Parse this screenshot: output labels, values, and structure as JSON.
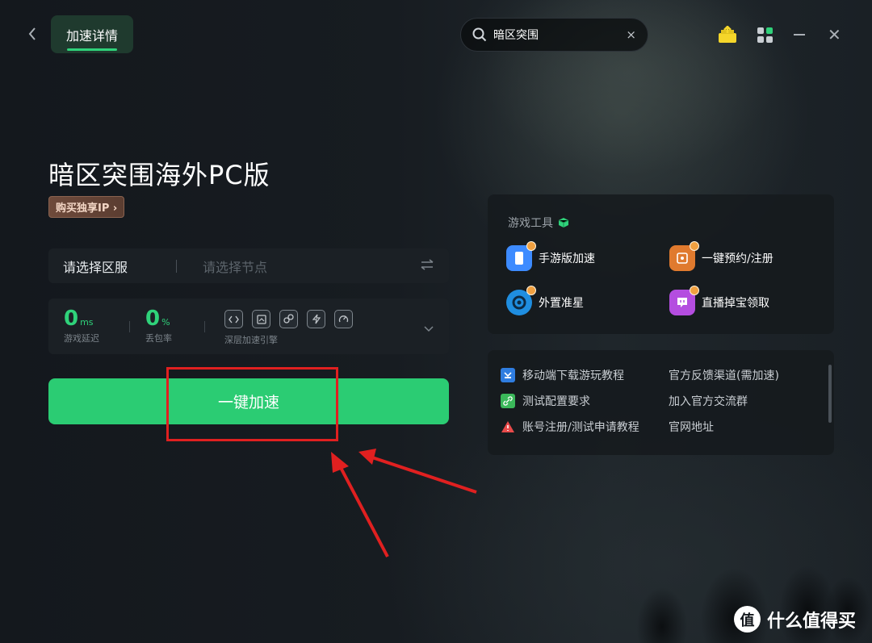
{
  "header": {
    "active_tab": "加速详情",
    "search": {
      "value": "暗区突围",
      "clear": "×"
    },
    "window": {
      "close": "✕"
    }
  },
  "game": {
    "title": "暗区突围海外PC版",
    "buy_ip": "购买独享IP ›"
  },
  "region": {
    "label": "请选择区服",
    "node_placeholder": "请选择节点"
  },
  "stats": {
    "latency": {
      "value": "0",
      "unit": "ms",
      "label": "游戏延迟"
    },
    "packet_loss": {
      "value": "0",
      "unit": "%",
      "label": "丢包率"
    },
    "engine_label": "深层加速引擎"
  },
  "accelerate_button": "一键加速",
  "tools": {
    "title": "游戏工具",
    "items": [
      {
        "label": "手游版加速",
        "icon": "mobile-accelerate-icon",
        "color": "#3d8bff"
      },
      {
        "label": "一键预约/注册",
        "icon": "reserve-register-icon",
        "color": "#e07a2e"
      },
      {
        "label": "外置准星",
        "icon": "crosshair-icon",
        "color": "#1f8ee0"
      },
      {
        "label": "直播掉宝领取",
        "icon": "live-drop-icon",
        "color": "#b44de0"
      }
    ]
  },
  "links": [
    {
      "label": "移动端下载游玩教程",
      "icon": "mobile-tutorial-icon"
    },
    {
      "label": "官方反馈渠道(需加速)",
      "icon": ""
    },
    {
      "label": "测试配置要求",
      "icon": "link-icon"
    },
    {
      "label": "加入官方交流群",
      "icon": ""
    },
    {
      "label": "账号注册/测试申请教程",
      "icon": "warning-icon"
    },
    {
      "label": "官网地址",
      "icon": ""
    }
  ],
  "watermark": {
    "text": "什么值得买",
    "logo": "值"
  },
  "colors": {
    "accent": "#2bcc73",
    "highlight": "#e02020"
  }
}
